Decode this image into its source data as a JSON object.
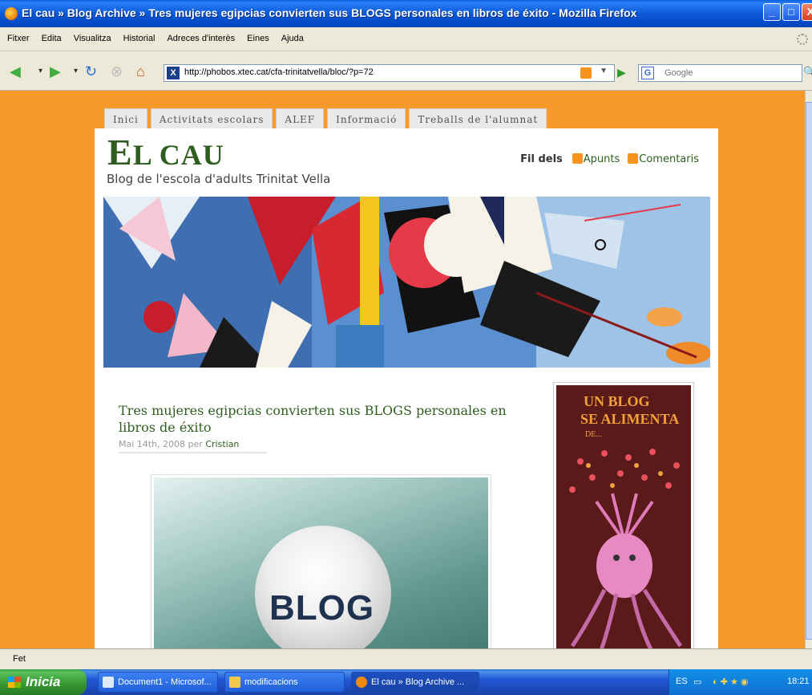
{
  "window": {
    "title": "El cau » Blog Archive » Tres mujeres egipcias convierten sus BLOGS personales en libros de éxito - Mozilla Firefox"
  },
  "menu": [
    "Fitxer",
    "Edita",
    "Visualitza",
    "Historial",
    "Adreces d'interès",
    "Eines",
    "Ajuda"
  ],
  "nav": {
    "url": "http://phobos.xtec.cat/cfa-trinitatvella/bloc/?p=72",
    "search_placeholder": "Google",
    "search_engine_icon": "G"
  },
  "site": {
    "tabs": [
      "Inici",
      "Activitats escolars",
      "ALEF",
      "Informació",
      "Treballs de l'alumnat"
    ],
    "title_first": "E",
    "title_rest": "L CAU",
    "tagline": "Blog de l'escola d'adults Trinitat Vella",
    "feeds_label": "Fil dels",
    "feed_posts": "Apunts",
    "feed_comments": "Comentaris"
  },
  "post": {
    "title": "Tres mujeres egipcias convierten sus BLOGS personales en libros de éxito",
    "date": "Mai 14th, 2008 per ",
    "author": "Cristian",
    "image_text": "BLOG"
  },
  "sidebar": {
    "line1": "UN BLOG",
    "line2": "SE ALIMENTA",
    "line3": "DE..."
  },
  "status": "Fet",
  "taskbar": {
    "start": "Inicia",
    "buttons": [
      "Document1 - Microsof...",
      "modificacions",
      "El cau » Blog Archive ..."
    ],
    "lang": "ES",
    "clock": "18:21"
  }
}
